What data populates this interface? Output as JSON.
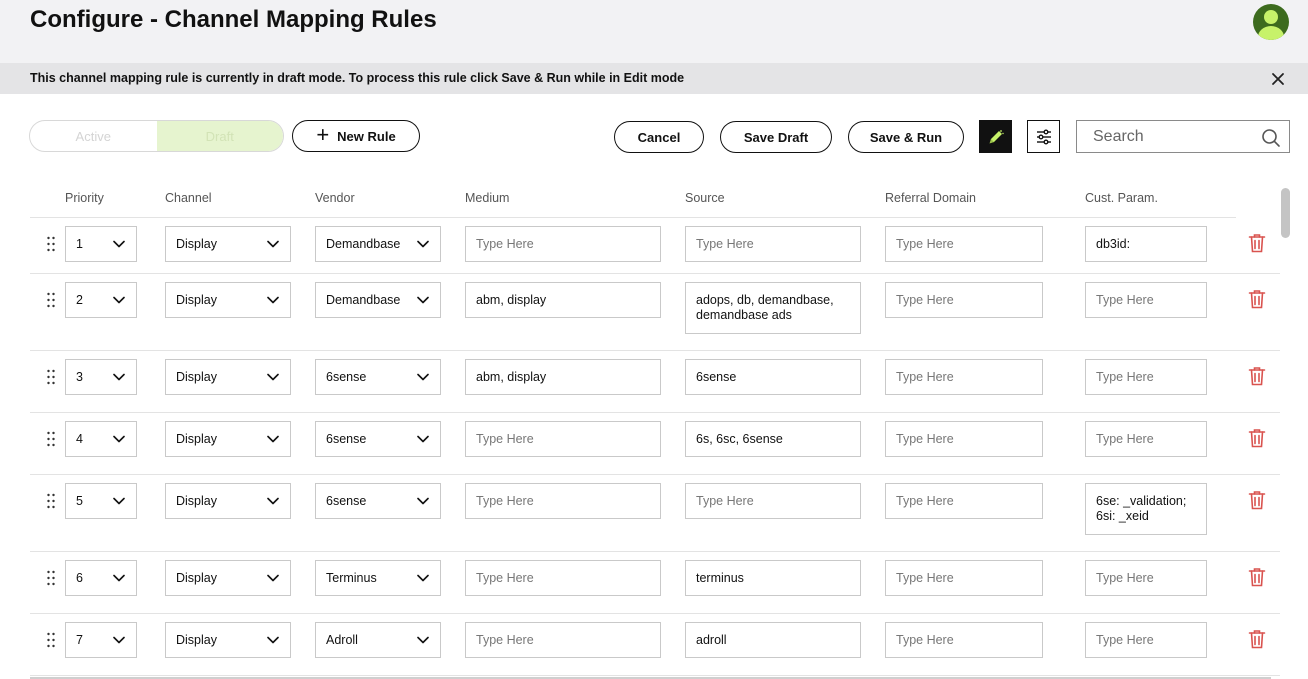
{
  "header": {
    "title": "Configure - Channel Mapping Rules"
  },
  "banner": {
    "text": "This channel mapping rule is currently in draft mode. To process this rule click Save & Run while in Edit mode"
  },
  "toolbar": {
    "toggle_active": "Active",
    "toggle_draft": "Draft",
    "new_rule": "New Rule",
    "cancel": "Cancel",
    "save_draft": "Save Draft",
    "save_run": "Save & Run",
    "search_placeholder": "Search"
  },
  "colors": {
    "draft_bg": "#e6f4cf",
    "accent_green": "#c7f26a",
    "avatar_dark": "#3d6b1e",
    "delete_red": "#d9534f"
  },
  "icons": {
    "banner_close": "close-icon",
    "new_rule": "plus-icon",
    "edit": "pencil-icon",
    "settings": "sliders-icon",
    "search": "search-icon",
    "row_drag": "drag-handle-icon",
    "row_delete": "trash-icon",
    "dropdown": "chevron-down-icon",
    "user": "user-avatar-icon"
  },
  "table": {
    "columns": [
      "Priority",
      "Channel",
      "Vendor",
      "Medium",
      "Source",
      "Referral Domain",
      "Cust. Param."
    ],
    "rows": [
      {
        "priority": "1",
        "channel": "Display",
        "vendor": "Demandbase",
        "medium": "",
        "source": "",
        "referral": "",
        "param": "db3id:"
      },
      {
        "priority": "2",
        "channel": "Display",
        "vendor": "Demandbase",
        "medium": "abm, display",
        "source": "adops, db, demandbase, demandbase ads",
        "referral": "",
        "param": ""
      },
      {
        "priority": "3",
        "channel": "Display",
        "vendor": "6sense",
        "medium": "abm, display",
        "source": "6sense",
        "referral": "",
        "param": ""
      },
      {
        "priority": "4",
        "channel": "Display",
        "vendor": "6sense",
        "medium": "",
        "source": "6s, 6sc, 6sense",
        "referral": "",
        "param": ""
      },
      {
        "priority": "5",
        "channel": "Display",
        "vendor": "6sense",
        "medium": "",
        "source": "",
        "referral": "",
        "param": "6se: _validation; 6si: _xeid"
      },
      {
        "priority": "6",
        "channel": "Display",
        "vendor": "Terminus",
        "medium": "",
        "source": "terminus",
        "referral": "",
        "param": ""
      },
      {
        "priority": "7",
        "channel": "Display",
        "vendor": "Adroll",
        "medium": "",
        "source": "adroll",
        "referral": "",
        "param": ""
      }
    ],
    "placeholder": "Type Here"
  }
}
